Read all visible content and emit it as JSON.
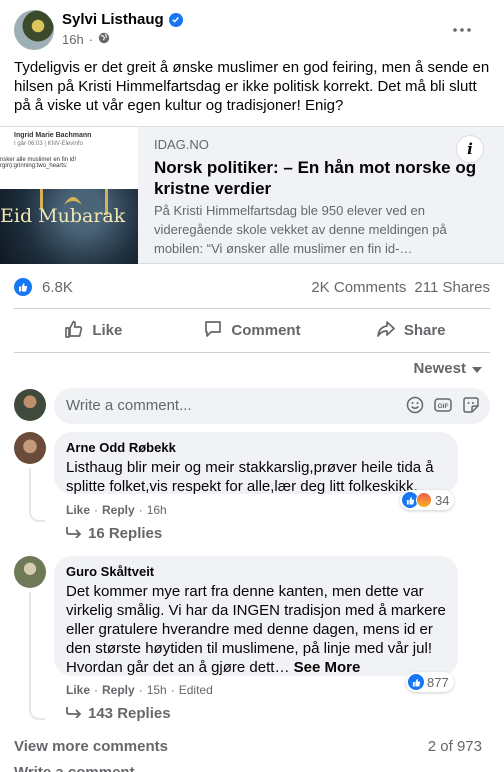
{
  "post": {
    "author": "Sylvi Listhaug",
    "time": "16h",
    "separator": "·",
    "text": "Tydeligvis er det greit å ønske muslimer en god feiring, men å sende en hilsen på Kristi Himmelfartsdag er ikke politisk korrekt. Det må bli slutt på å viske ut vår egen kultur og tradisjoner! Enig?"
  },
  "link": {
    "source": "IDAG.NO",
    "title": "Norsk politiker: – En hån mot norske og kristne verdier",
    "description": "På Kristi Himmelfartsdag ble 950 elever ved en videregående skole vekket av denne meldingen på mobilen: “Vi ønsker alle muslimer en fin id-…",
    "info": "i",
    "thumb": {
      "name": "Ingrid Marie Bachmann",
      "sub": "I går 06:03 | KNV-Elevinfo",
      "text": "nsker alle muslimer en fin id!",
      "text2": "rgin):grinning:two_hearts:",
      "banner": "Eid Mubarak"
    }
  },
  "stats": {
    "reactions": "6.8K",
    "comments": "2K Comments",
    "shares": "211 Shares"
  },
  "actions": {
    "like": "Like",
    "comment": "Comment",
    "share": "Share"
  },
  "sort": {
    "label": "Newest"
  },
  "composer": {
    "placeholder": "Write a comment..."
  },
  "comments": [
    {
      "author": "Arne Odd Røbekk",
      "text": "Listhaug blir meir og meir stakkarslig,prøver heile tida å splitte folket,vis respekt for alle,lær deg litt folkeskikk.",
      "like": "Like",
      "reply": "Reply",
      "time": "16h",
      "reactions": "34",
      "replies": "16 Replies"
    },
    {
      "author": "Guro Skåltveit",
      "text": "Det kommer mye rart fra denne kanten, men dette var virkelig smålig. Vi har da INGEN tradisjon med å markere eller gratulere hverandre med denne dagen, mens id er den største høytiden til muslimene, på linje med vår jul! Hvordan går det an å gjøre dett…",
      "see_more": "See More",
      "like": "Like",
      "reply": "Reply",
      "time": "15h",
      "edited": "Edited",
      "reactions": "877",
      "replies": "143 Replies"
    }
  ],
  "footer": {
    "view_more": "View more comments",
    "count": "2 of 973",
    "cut": "Write a comment..."
  },
  "colors": {
    "accent": "#1877f2",
    "secondary_text": "#65676b",
    "bubble": "#f0f2f5"
  }
}
